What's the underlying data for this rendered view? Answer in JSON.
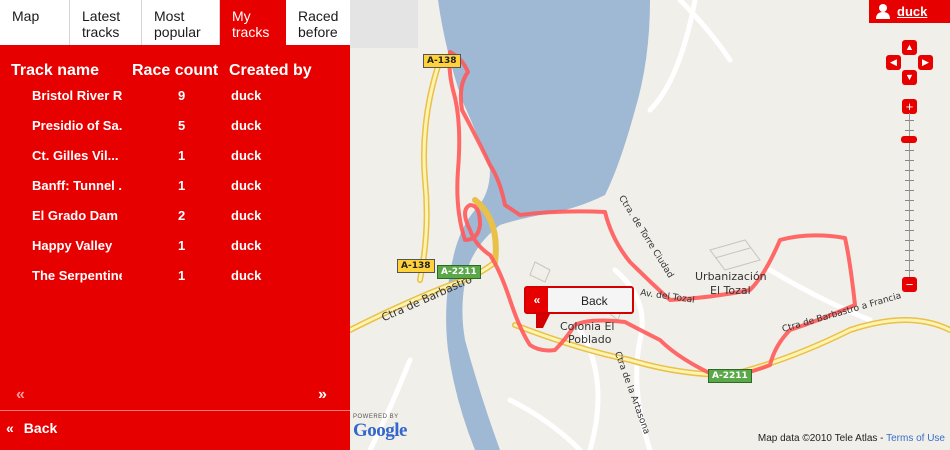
{
  "tabs": [
    {
      "label": "Map",
      "active": false
    },
    {
      "label": "Latest tracks",
      "active": false
    },
    {
      "label": "Most popular",
      "active": false
    },
    {
      "label": "My tracks",
      "active": true
    },
    {
      "label": "Raced before",
      "active": false
    }
  ],
  "table": {
    "headers": {
      "name": "Track name",
      "count": "Race count",
      "creator": "Created by"
    },
    "rows": [
      {
        "name": "Bristol River Run",
        "count": "9",
        "creator": "duck"
      },
      {
        "name": "Presidio of Sa...",
        "count": "5",
        "creator": "duck"
      },
      {
        "name": "Ct. Gilles Vil...",
        "count": "1",
        "creator": "duck"
      },
      {
        "name": "Banff: Tunnel ...",
        "count": "1",
        "creator": "duck"
      },
      {
        "name": "El Grado Dam",
        "count": "2",
        "creator": "duck"
      },
      {
        "name": "Happy Valley",
        "count": "1",
        "creator": "duck"
      },
      {
        "name": "The Serpentine",
        "count": "1",
        "creator": "duck"
      }
    ]
  },
  "pager": {
    "prev": "«",
    "next": "»"
  },
  "back": {
    "arrow": "«",
    "label": "Back"
  },
  "user": {
    "name": "duck"
  },
  "map": {
    "labels": {
      "ctra_barbastro_left": "Ctra de Barbastro",
      "urbanizacion": "Urbanización",
      "el_tozal": "El Tozal",
      "colonia": "Colonia El",
      "poblado": "Poblado",
      "ctra_artasona": "Ctra de la Artasona",
      "av_tozal": "Av. del Tozal",
      "ctra_barbastro_francia": "Ctra de Barbastro a Francia",
      "ctra_torre_ciudad": "Ctra. de Torre Ciudad"
    },
    "signs": {
      "a138_top": "A-138",
      "a138_left": "A-138",
      "a2211_left": "A-2211",
      "a2211_right": "A-2211"
    },
    "bubble": {
      "arrow": "«",
      "label": "Back"
    },
    "powered_by": "POWERED BY",
    "google": "Google",
    "attribution": "Map data ©2010  Tele Atlas - ",
    "terms": "Terms of Use",
    "nav": {
      "up": "▲",
      "down": "▼",
      "left": "◀",
      "right": "▶",
      "zoom_in": "+",
      "zoom_out": "−"
    }
  },
  "colors": {
    "accent": "#e60000",
    "route": "#ff5a5a",
    "water": "#9fb8d4",
    "land": "#f1efe9"
  }
}
